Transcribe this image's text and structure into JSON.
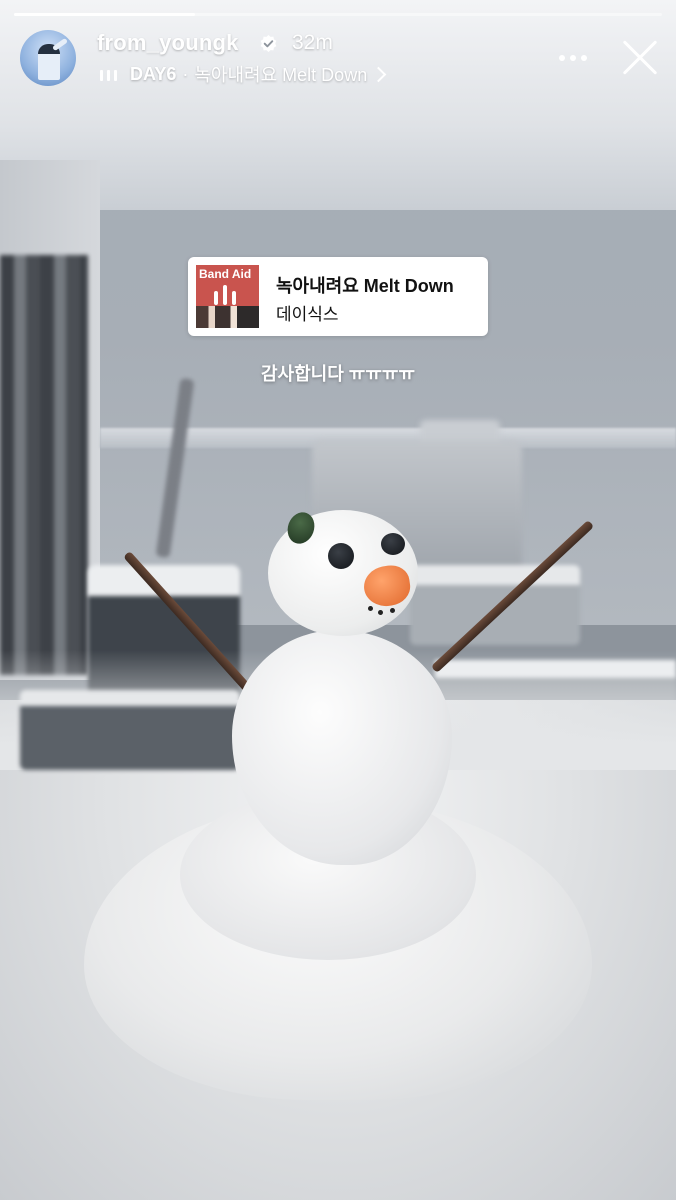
{
  "story": {
    "progress": 0.28,
    "user": {
      "username": "from_youngk",
      "verified": true,
      "time_ago": "32m"
    },
    "music": {
      "artist": "DAY6",
      "separator": "·",
      "song": "녹아내려요 Melt Down"
    },
    "sticker": {
      "album_title": "Band Aid",
      "song_title": "녹아내려요 Melt Down",
      "artist_korean": "데이식스"
    },
    "caption": "감사합니다 ㅠㅠㅠㅠ",
    "icons": {
      "more": "more-icon",
      "close": "close-icon",
      "verified": "verified-badge-icon",
      "music": "music-bars-icon",
      "chevron": "chevron-right-icon"
    },
    "colors": {
      "verified_badge": "#ffffff",
      "sticker_bg": "#ffffff",
      "album_bg": "#c9544e",
      "nose": "#f28a4b"
    }
  }
}
